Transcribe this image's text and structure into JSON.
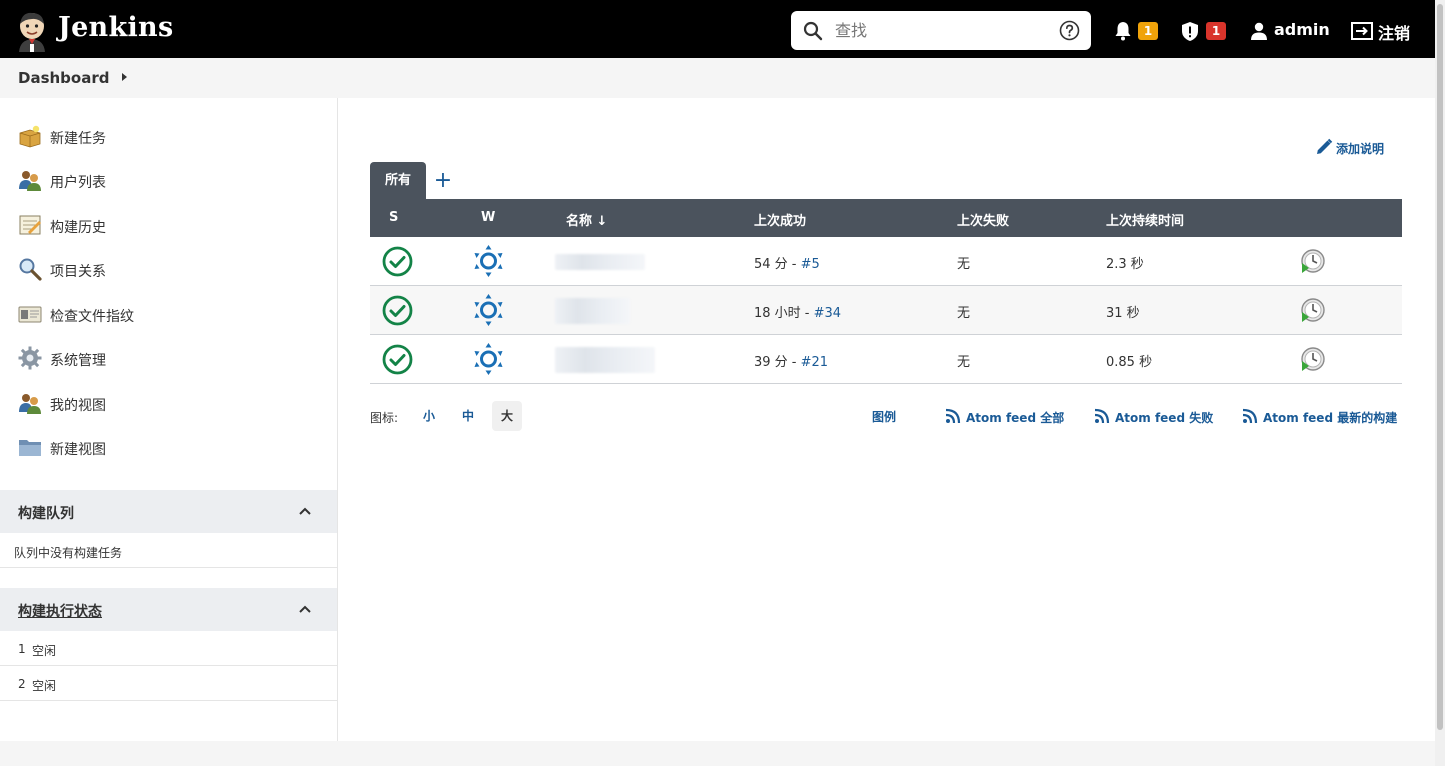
{
  "header": {
    "brand": "Jenkins",
    "search_placeholder": "查找",
    "notifications_count": "1",
    "security_count": "1",
    "user": "admin",
    "logout": "注销",
    "notif_color": "#f0a30a",
    "security_color": "#d9342b"
  },
  "breadcrumb": {
    "item": "Dashboard"
  },
  "sidebar": {
    "tasks": [
      {
        "label": "新建任务",
        "icon": "new-item-icon"
      },
      {
        "label": "用户列表",
        "icon": "users-icon"
      },
      {
        "label": "构建历史",
        "icon": "build-history-icon"
      },
      {
        "label": "项目关系",
        "icon": "search-icon"
      },
      {
        "label": "检查文件指纹",
        "icon": "fingerprint-icon"
      },
      {
        "label": "系统管理",
        "icon": "gear-icon"
      },
      {
        "label": "我的视图",
        "icon": "users-icon"
      },
      {
        "label": "新建视图",
        "icon": "folder-icon"
      }
    ],
    "build_queue": {
      "title": "构建队列",
      "empty": "队列中没有构建任务"
    },
    "executors": {
      "title": "构建执行状态",
      "items": [
        {
          "num": "1",
          "status": "空闲"
        },
        {
          "num": "2",
          "status": "空闲"
        }
      ]
    }
  },
  "main": {
    "add_description": "添加说明",
    "tab_all": "所有",
    "columns": {
      "s": "S",
      "w": "W",
      "name": "名称 ↓",
      "last_success": "上次成功",
      "last_failure": "上次失败",
      "last_duration": "上次持续时间"
    },
    "jobs": [
      {
        "since": "54 分 - ",
        "build": "#5",
        "failure": "无",
        "duration": "2.3 秒"
      },
      {
        "since": "18 小时 - ",
        "build": "#34",
        "failure": "无",
        "duration": "31 秒"
      },
      {
        "since": "39 分 - ",
        "build": "#21",
        "failure": "无",
        "duration": "0.85 秒"
      }
    ],
    "icon_label": "图标:",
    "icon_sizes": [
      "小",
      "中",
      "大"
    ],
    "legend": "图例",
    "feed_all": "Atom feed 全部",
    "feed_fail": "Atom feed 失败",
    "feed_latest": "Atom feed 最新的构建"
  }
}
